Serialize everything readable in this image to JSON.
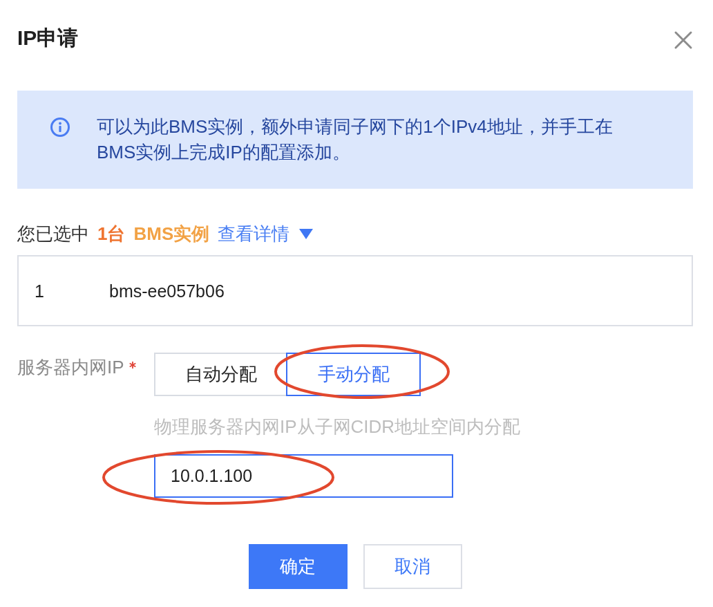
{
  "dialog": {
    "title": "IP申请"
  },
  "notice": {
    "text": "可以为此BMS实例，额外申请同子网下的1个IPv4地址，并手工在BMS实例上完成IP的配置添加。"
  },
  "selection": {
    "label": "您已选中",
    "count": "1台",
    "target": "BMS实例",
    "details_link": "查看详情"
  },
  "instances": [
    {
      "index": "1",
      "name": "bms-ee057b06"
    }
  ],
  "ip_field": {
    "label": "服务器内网IP",
    "required": true,
    "options": [
      {
        "label": "自动分配",
        "selected": false,
        "circled": false
      },
      {
        "label": "手动分配",
        "selected": true,
        "circled": true
      }
    ],
    "hint": "物理服务器内网IP从子网CIDR地址空间内分配",
    "input": {
      "value": "10.0.1.100",
      "circled": true
    }
  },
  "buttons": [
    {
      "label": "确定",
      "kind": "primary"
    },
    {
      "label": "取消",
      "kind": "secondary"
    }
  ]
}
